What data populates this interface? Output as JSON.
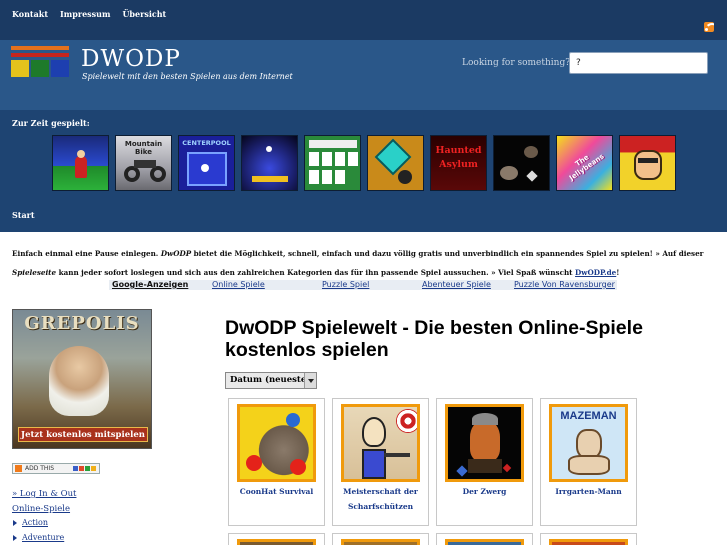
{
  "topnav": {
    "items": [
      "Kontakt",
      "Impressum",
      "Übersicht"
    ]
  },
  "header": {
    "title": "DWODP",
    "subtitle": "Spielewelt mit den besten Spielen aus dem Internet",
    "search_label": "Looking for something?",
    "search_value": "?"
  },
  "played": {
    "label": "Zur Zeit gespielt:",
    "thumbs": [
      {
        "name": "game-thumb-1"
      },
      {
        "name": "game-thumb-2",
        "text": "Mountain Bike"
      },
      {
        "name": "game-thumb-3",
        "text": "CENTERPOOL"
      },
      {
        "name": "game-thumb-4"
      },
      {
        "name": "game-thumb-5"
      },
      {
        "name": "game-thumb-6"
      },
      {
        "name": "game-thumb-7",
        "text": "Haunted Asylum"
      },
      {
        "name": "game-thumb-8"
      },
      {
        "name": "game-thumb-9",
        "text": "The Jellybeans"
      },
      {
        "name": "game-thumb-10"
      }
    ],
    "start_label": "Start"
  },
  "intro": {
    "p1": "Einfach einmal eine Pause einlegen.",
    "brand": "DwODP",
    "p2": "bietet die Möglichkeit, schnell, einfach und dazu völlig gratis und unverbindlich ein spannendes Spiel zu spielen! » Auf dieser",
    "spieleseite": "Spieleseite",
    "p3": "kann jeder sofort loslegen und sich aus den zahlreichen Kategorien das für ihn passende Spiel aussuchen. » Viel Spaß wünscht",
    "link": "DwODP.de",
    "p4": "!"
  },
  "ads": {
    "title": "Google-Anzeigen",
    "links": [
      "Online Spiele",
      "Puzzle Spiel",
      "Abenteuer Spiele",
      "Puzzle Von Ravensburger"
    ]
  },
  "sidebar": {
    "banner_title": "GREPOLIS",
    "banner_cta": "Jetzt kostenlos mitspielen",
    "addthis": "ADD THIS",
    "login": "» Log In & Out",
    "category_title": "Online-Spiele",
    "categories": [
      "Action",
      "Adventure"
    ]
  },
  "main": {
    "title": "DwODP Spielewelt - Die besten Online-Spiele kostenlos spielen",
    "sort_value": "Datum (neueste)",
    "games": [
      {
        "title": "CoonHat Survival"
      },
      {
        "title": "Meisterschaft der Scharfschützen"
      },
      {
        "title": "Der Zwerg"
      },
      {
        "title": "Irrgarten-Mann",
        "img_text": "MAZEMAN"
      }
    ]
  },
  "colors": {
    "topbar": "#1b3a63",
    "header": "#2a5789",
    "played_bg": "#1e4472",
    "link": "#1a3a8a",
    "card_border": "#f09a0c"
  }
}
